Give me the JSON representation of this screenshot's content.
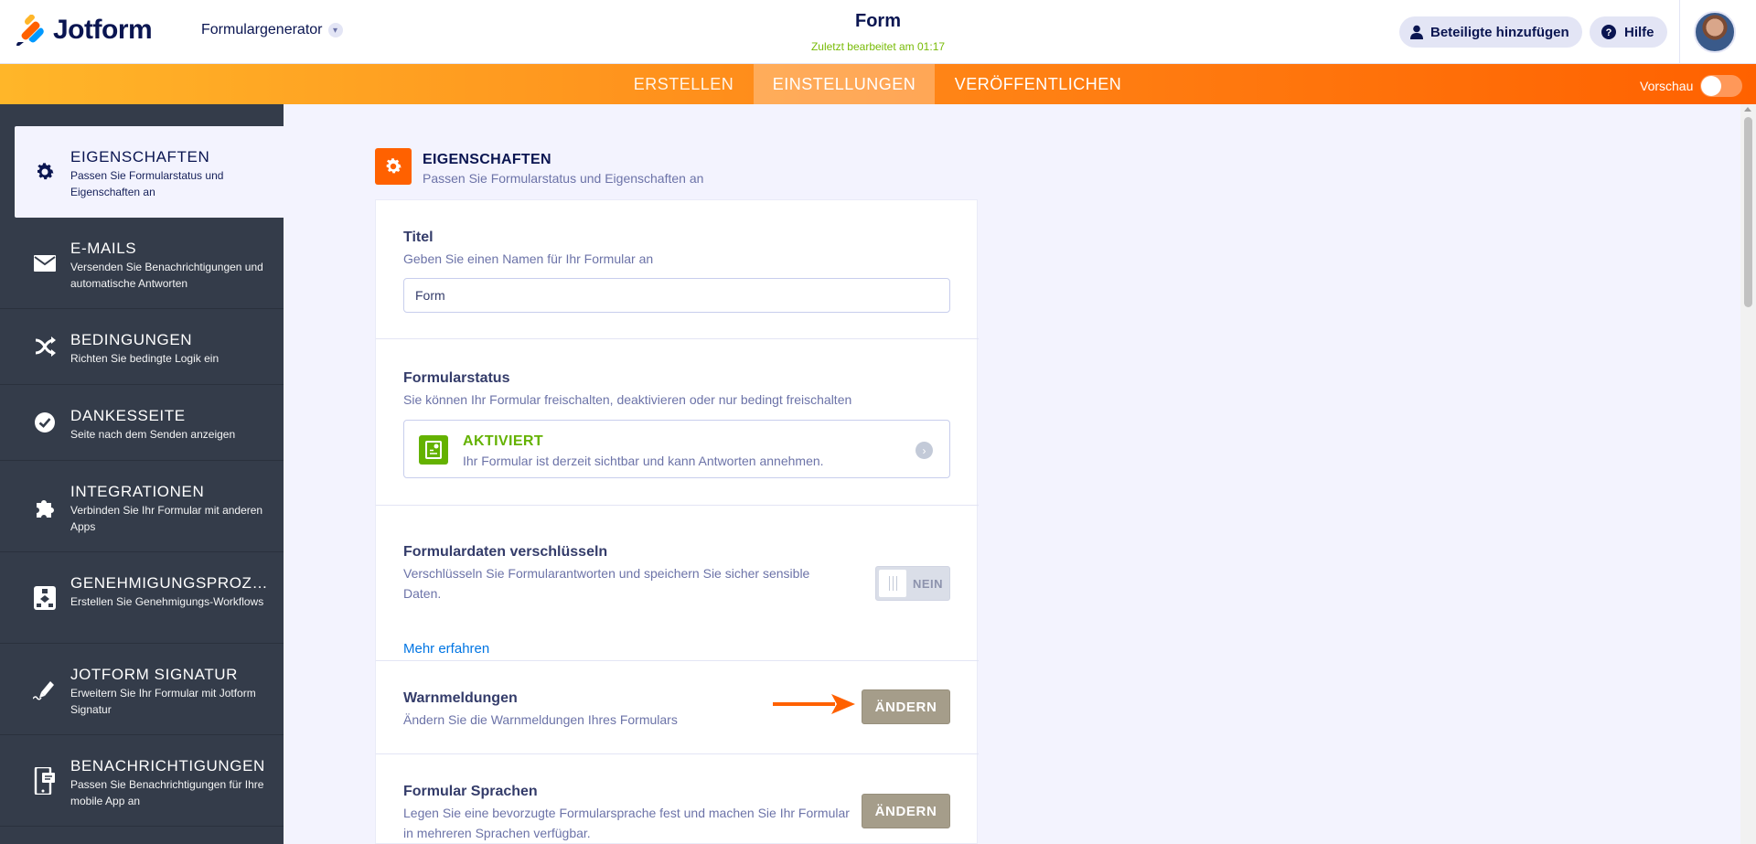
{
  "header": {
    "brand": "Jotform",
    "generator": "Formulargenerator",
    "form_title": "Form",
    "last_edited": "Zuletzt bearbeitet am 01:17",
    "collab_button": "Beteiligte hinzufügen",
    "help_button": "Hilfe"
  },
  "nav": {
    "tabs": [
      {
        "label": "ERSTELLEN"
      },
      {
        "label": "EINSTELLUNGEN"
      },
      {
        "label": "VERÖFFENTLICHEN"
      }
    ],
    "preview_label": "Vorschau"
  },
  "sidebar": {
    "items": [
      {
        "title": "EIGENSCHAFTEN",
        "sub": "Passen Sie Formularstatus und Eigenschaften an",
        "icon": "gear-icon"
      },
      {
        "title": "E-MAILS",
        "sub": "Versenden Sie Benachrichtigungen und automatische Antworten",
        "icon": "envelope-icon"
      },
      {
        "title": "BEDINGUNGEN",
        "sub": "Richten Sie bedingte Logik ein",
        "icon": "shuffle-icon"
      },
      {
        "title": "DANKESSEITE",
        "sub": "Seite nach dem Senden anzeigen",
        "icon": "check-circle-icon"
      },
      {
        "title": "INTEGRATIONEN",
        "sub": "Verbinden Sie Ihr Formular mit anderen Apps",
        "icon": "puzzle-icon"
      },
      {
        "title": "GENEHMIGUNGSPROZESSE",
        "sub": "Erstellen Sie Genehmigungs-Workflows",
        "icon": "workflow-icon"
      },
      {
        "title": "JOTFORM SIGNATUR",
        "sub": "Erweitern Sie Ihr Formular mit Jotform Signatur",
        "icon": "pen-icon"
      },
      {
        "title": "BENACHRICHTIGUNGEN",
        "sub": "Passen Sie Benachrichtigungen für Ihre mobile App an",
        "icon": "mobile-icon"
      }
    ]
  },
  "main": {
    "section_title": "EIGENSCHAFTEN",
    "section_sub": "Passen Sie Formularstatus und Eigenschaften an",
    "title_label": "Titel",
    "title_desc": "Geben Sie einen Namen für Ihr Formular an",
    "title_value": "Form",
    "status_label": "Formularstatus",
    "status_desc": "Sie können Ihr Formular freischalten, deaktivieren oder nur bedingt freischalten",
    "status_value": "AKTIVIERT",
    "status_value_desc": "Ihr Formular ist derzeit sichtbar und kann Antworten annehmen.",
    "encrypt_label": "Formulardaten verschlüsseln",
    "encrypt_desc": "Verschlüsseln Sie Formularantworten und speichern Sie sicher sensible Daten.",
    "encrypt_link": "Mehr erfahren",
    "encrypt_toggle": "NEIN",
    "warn_label": "Warnmeldungen",
    "warn_desc": "Ändern Sie die Warnmeldungen Ihres Formulars",
    "warn_button": "ÄNDERN",
    "lang_label": "Formular Sprachen",
    "lang_desc": "Legen Sie eine bevorzugte Formularsprache fest und machen Sie Ihr Formular in mehreren Sprachen verfügbar.",
    "lang_button": "ÄNDERN"
  },
  "colors": {
    "accent": "#ff6100",
    "sidebar": "#343c4a",
    "active_green": "#64b200",
    "change_button": "#a59d8a",
    "link": "#0075e3"
  }
}
